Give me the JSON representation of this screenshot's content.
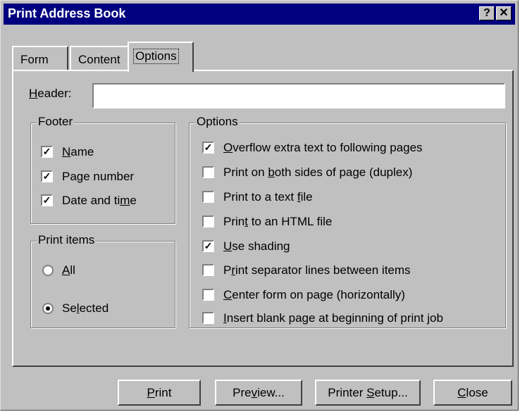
{
  "window": {
    "title": "Print Address Book",
    "help_glyph": "?",
    "close_glyph": "✕"
  },
  "tabs": [
    {
      "label": "Form"
    },
    {
      "label": "Content"
    },
    {
      "label": "Options",
      "active": true
    }
  ],
  "header": {
    "label_first": "H",
    "label_rest": "eader:",
    "value": ""
  },
  "footer": {
    "legend": "Footer",
    "items": [
      {
        "pre": "",
        "u": "N",
        "post": "ame",
        "checked": true
      },
      {
        "pre": "Page number",
        "u": "",
        "post": "",
        "checked": true
      },
      {
        "pre": "Date and ti",
        "u": "m",
        "post": "e",
        "checked": true
      }
    ]
  },
  "print_items": {
    "legend": "Print items",
    "items": [
      {
        "pre": "",
        "u": "A",
        "post": "ll",
        "selected": false
      },
      {
        "pre": "Se",
        "u": "l",
        "post": "ected",
        "selected": true
      }
    ]
  },
  "options": {
    "legend": "Options",
    "items": [
      {
        "pre": "",
        "u": "O",
        "post": "verflow extra text to following pages",
        "checked": true
      },
      {
        "pre": "Print on ",
        "u": "b",
        "post": "oth sides of page (duplex)",
        "checked": false
      },
      {
        "pre": "Print to a text ",
        "u": "f",
        "post": "ile",
        "checked": false
      },
      {
        "pre": "Prin",
        "u": "t",
        "post": " to an HTML file",
        "checked": false
      },
      {
        "pre": "",
        "u": "U",
        "post": "se shading",
        "checked": true
      },
      {
        "pre": "P",
        "u": "r",
        "post": "int separator lines between items",
        "checked": false
      },
      {
        "pre": "",
        "u": "C",
        "post": "enter form on page (horizontally)",
        "checked": false
      },
      {
        "pre": "",
        "u": "I",
        "post": "nsert blank page at beginning of print job",
        "checked": false
      }
    ]
  },
  "buttons": [
    {
      "pre": "",
      "u": "P",
      "post": "rint"
    },
    {
      "pre": "Pre",
      "u": "v",
      "post": "iew..."
    },
    {
      "pre": "Printer ",
      "u": "S",
      "post": "etup..."
    },
    {
      "pre": "",
      "u": "C",
      "post": "lose"
    }
  ],
  "check_glyph": "✓"
}
